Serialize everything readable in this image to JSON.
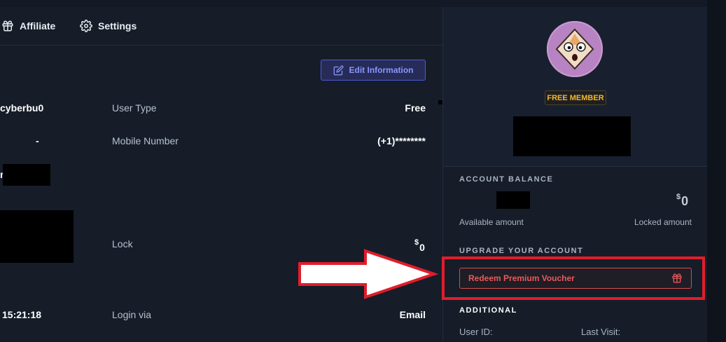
{
  "nav": {
    "affiliate_label": "Affiliate",
    "settings_label": "Settings"
  },
  "edit_button": {
    "label": "Edit Information"
  },
  "profile": {
    "username_fragment": "cyberbu0",
    "dash_value": "-",
    "label_fragment": "r",
    "time_fragment": "15:21:18",
    "user_type_label": "User Type",
    "user_type_value": "Free",
    "mobile_label": "Mobile Number",
    "mobile_value": "(+1)********",
    "lock_label": "Lock",
    "lock_currency": "$",
    "lock_value": "0",
    "login_via_label": "Login via",
    "login_via_value": "Email"
  },
  "sidebar": {
    "member_badge": "FREE MEMBER",
    "account_balance_title": "ACCOUNT BALANCE",
    "locked_currency": "$",
    "locked_value": "0",
    "available_amount_label": "Available amount",
    "locked_amount_label": "Locked amount",
    "upgrade_title": "UPGRADE YOUR ACCOUNT",
    "voucher_button_label": "Redeem Premium Voucher",
    "additional_title": "ADDITIONAL",
    "user_id_label": "User ID:",
    "last_visit_label": "Last Visit:"
  },
  "colors": {
    "background": "#161d29",
    "accent_indigo": "#4f5ad6",
    "badge_gold": "#f3b62f",
    "voucher_red": "#ea5a5a",
    "highlight_red": "#e11d2b"
  },
  "icons": [
    "gift-icon",
    "gear-icon",
    "edit-icon",
    "avatar-face-icon",
    "gift-icon"
  ]
}
